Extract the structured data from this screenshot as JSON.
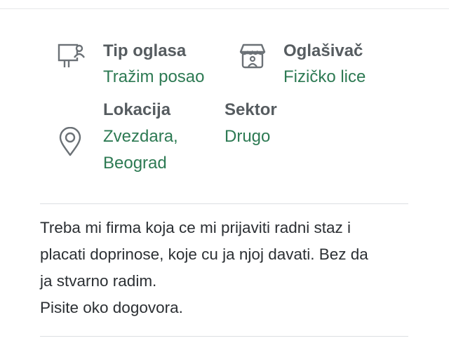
{
  "details": {
    "ad_type": {
      "label": "Tip oglasa",
      "value": "Tražim posao",
      "icon": "billboard-person-icon"
    },
    "advertiser": {
      "label": "Oglašivač",
      "value": "Fizičko lice",
      "icon": "storefront-icon"
    },
    "location": {
      "label": "Lokacija",
      "value_line1": "Zvezdara,",
      "value_line2": "Beograd",
      "icon": "location-pin-icon"
    },
    "sector": {
      "label": "Sektor",
      "value": "Drugo"
    }
  },
  "description": {
    "lines": [
      "Treba mi firma koja ce mi prijaviti radni staz i",
      "placati doprinose, koje cu ja njoj davati. Bez da",
      "ja stvarno radim.",
      "Pisite oko dogovora."
    ]
  },
  "colors": {
    "label": "#565c60",
    "value_green": "#2d7a53",
    "icon_gray": "#6b7176",
    "divider": "#dcdfe2"
  }
}
